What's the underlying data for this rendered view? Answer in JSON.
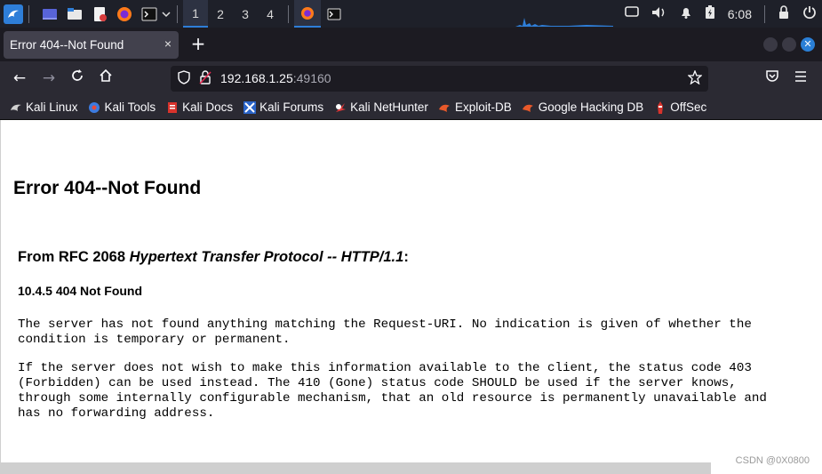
{
  "taskbar": {
    "workspaces": [
      "1",
      "2",
      "3",
      "4"
    ],
    "active_workspace": "1",
    "clock": "6:08"
  },
  "browser": {
    "tab_title": "Error 404--Not Found",
    "tab_close": "×",
    "new_tab": "+",
    "url": {
      "host": "192.168.1.25",
      "port": ":49160"
    },
    "bookmarks": [
      {
        "label": "Kali Linux",
        "icon": "kali-dragon-icon"
      },
      {
        "label": "Kali Tools",
        "icon": "kali-tools-icon"
      },
      {
        "label": "Kali Docs",
        "icon": "kali-docs-icon"
      },
      {
        "label": "Kali Forums",
        "icon": "kali-forums-icon"
      },
      {
        "label": "Kali NetHunter",
        "icon": "kali-nethunter-icon"
      },
      {
        "label": "Exploit-DB",
        "icon": "exploit-db-icon"
      },
      {
        "label": "Google Hacking DB",
        "icon": "ghdb-icon"
      },
      {
        "label": "OffSec",
        "icon": "offsec-icon"
      }
    ]
  },
  "page": {
    "heading": "Error 404--Not Found",
    "rfc_prefix": "From RFC 2068 ",
    "rfc_title": "Hypertext Transfer Protocol -- HTTP/1.1",
    "rfc_suffix": ":",
    "section": "10.4.5 404 Not Found",
    "paragraph1": "The server has not found anything matching the Request-URI. No indication is given of whether the\ncondition is temporary or permanent.",
    "paragraph2": "If the server does not wish to make this information available to the client, the status code 403\n(Forbidden) can be used instead. The 410 (Gone) status code SHOULD be used if the server knows,\nthrough some internally configurable mechanism, that an old resource is permanently unavailable and\nhas no forwarding address."
  },
  "watermark": "CSDN @0X0800",
  "colors": {
    "taskbar_bg": "#1e2029",
    "browser_dark": "#1c1b22",
    "toolbar": "#2b2a33",
    "accent": "#2e7ed8"
  }
}
